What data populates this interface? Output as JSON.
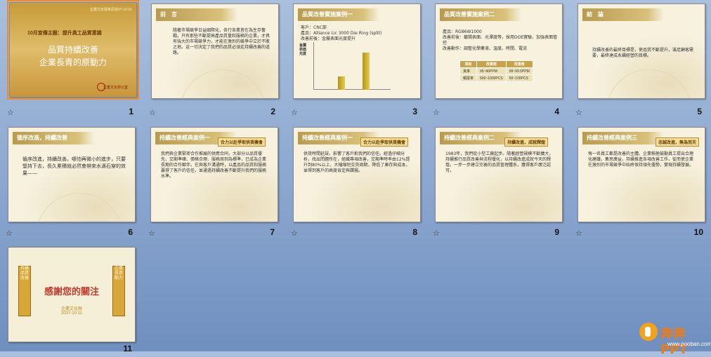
{
  "slides": [
    {
      "num": "1",
      "title": "",
      "top": "企業文化週末訊息07-10-01",
      "sub": "10月宣傳主題：提升員工品質意識",
      "line1": "品質持續改善",
      "line2": "企業長青的原動力",
      "logo": "企業文化辦公室"
    },
    {
      "num": "2",
      "title": "前　言",
      "body": "隨著市場競爭日益國際化，各行各業皆在為生存奮戰。只有那些不斷提高產品質量和服務的企業，才具有強大的市場競爭力，才能在激烈的競爭中立於不敗之地。這一切決定了我們的品質必須走持續改善的道路。"
    },
    {
      "num": "3",
      "title": "品質改善實施案例一",
      "l1": "客戶：CNC部",
      "l2": "產品：Alliance Lic 3000 Die Ring (split)",
      "l3": "改善前後：金屬表面光度提升"
    },
    {
      "num": "4",
      "title": "品質改善實施案例二",
      "l1": "產品：RG86W1000",
      "l2": "改善前後：鍍錫表面、光澤度等，採用DOE實驗，加強表面管控",
      "l3": "改善動作：調整化學藥液、溫度、時間、電流",
      "headers": [
        "項目",
        "改善前",
        "改善後"
      ],
      "rows": [
        [
          "良率",
          "95~96PPM",
          "99~99.5PPM"
        ],
        [
          "報廢率",
          "500~1000PCS",
          "50~100PCS"
        ]
      ]
    },
    {
      "num": "5",
      "title": "結　論",
      "body": "持續改善的最終目標是，使品質不斷提升，滿足顧客需要，最終達成永續經營的目標。"
    },
    {
      "num": "6",
      "title": "循序改進，持續改善",
      "body": "循序改進，持續改善。哪怕再微小的進步，只要堅持下去，長久累積就必然會帶來水滴石穿的效果——"
    },
    {
      "num": "7",
      "title": "持續改善經典案例一",
      "tag": "合力以赴爭取供貨機會",
      "body": "我們與企業緊密合作推展的供應合同，大部分以品質優先、交期準確、價格合理、服務周到為標準，已成為企業長期的合作夥伴。在與客戶溝通時，以產品的品質和服務贏得了客戶的信任，並通過持續改善不斷提升我們的服務水準。"
    },
    {
      "num": "8",
      "title": "持續改善經典案例一",
      "tag": "合力以赴爭取供貨機會",
      "body": "供貨時間延誤，影響了客戶對我們的信任。經過仔細分析，找出問題所在，組織專項改善，交期準時率由12%提升到80%以上，大幅縮短交貨周期，降低了庫存與成本，並得到客戶的高度肯定與讚揚。"
    },
    {
      "num": "9",
      "title": "持續改善經典案例二",
      "tag": "持續改進，成就輝煌",
      "body": "1983年，我們從小型工廠起步。隨著經營規模不斷擴大，持續推行品質改善與流程優化，以持續改進成就今天的輝煌。一步一步建立完善的品質管理體系，獲得客戶廣泛認可。"
    },
    {
      "num": "10",
      "title": "持續改善經典案例三",
      "tag": "忠誠改進，無為而天",
      "body": "每一名員工都是改善的主體。企業積極鼓勵員工提出合理化建議，集思廣益，持續推進各項改善工作，從而使企業在激烈的市場競爭中始終保持領先優勢，實現持續發展。"
    },
    {
      "num": "11",
      "title": "",
      "thanks": "感謝您的關注",
      "sig": "企業文化辦",
      "date": "2007-10-11",
      "pillar_left": "持續品質改善",
      "pillar_right": "企業長青動力"
    }
  ],
  "chart_data": {
    "type": "bar",
    "categories": [
      "改善前",
      "改善後"
    ],
    "values": [
      30,
      85
    ],
    "ylabel": "金屬表面光度"
  },
  "watermark": {
    "brand": "奔奔PPT",
    "url": "www.pooban.com"
  },
  "star": "☆"
}
